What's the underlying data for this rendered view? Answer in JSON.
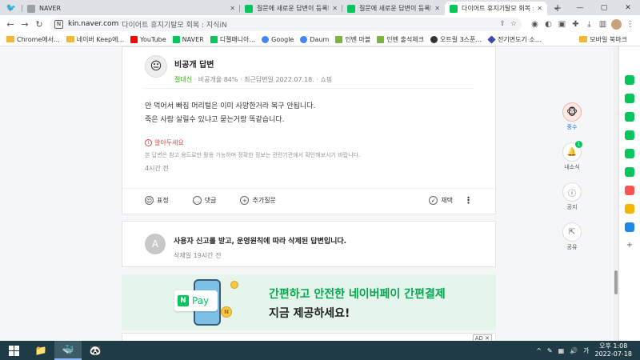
{
  "browser": {
    "tabs": [
      {
        "title": "",
        "pinned": true,
        "icon": "twitter-bird-icon"
      },
      {
        "title": "NAVER",
        "pinned": false
      },
      {
        "title": "질문에 새로운 답변이 등록되었",
        "pinned": false
      },
      {
        "title": "질문에 새로운 답변이 등록되었",
        "pinned": false
      },
      {
        "title": "다이어트 휴지기탈모 회복 : 지식",
        "pinned": false,
        "active": true
      }
    ],
    "new_tab": "+",
    "url": "kin.naver.com",
    "url_title": "다이어트 휴지기탈모 회복 : 지식iN",
    "omnibox_badge": "N",
    "window_controls": {
      "minimize": "—",
      "maximize": "▢",
      "close": "✕"
    }
  },
  "bookmarks": {
    "items": [
      {
        "label": "Chrome에서...",
        "type": "folder"
      },
      {
        "label": "네이버 Keep에...",
        "type": "folder"
      },
      {
        "label": "YouTube",
        "color": "#ff0000"
      },
      {
        "label": "NAVER",
        "color": "#03c75a"
      },
      {
        "label": "디젤매니아...",
        "color": "#03c75a"
      },
      {
        "label": "Google",
        "color": "#4285f4"
      },
      {
        "label": "Daum",
        "color": "#4285f4"
      },
      {
        "label": "인벤 마블",
        "color": "#7cb342"
      },
      {
        "label": "인벤 출석체크",
        "color": "#7cb342"
      },
      {
        "label": "오트릴 3스푼...",
        "color": "#333333"
      },
      {
        "label": "전기면도기 소...",
        "color": "#3949ab"
      }
    ],
    "right_folder": "모바일 북마크"
  },
  "answer": {
    "title": "비공개 답변",
    "grade": "절대신",
    "meta_rest": "· 비공개율 84% · 최근답변일 2022.07.18. · 쇼핑",
    "body_lines": [
      "안 먹어서 빠짐 머리털은 이미 사망한거라 복구 안됩니다.",
      "죽은 사람 살릴수 있냐고 묻는거랑 똑같습니다."
    ],
    "notice_title": "알아두세요",
    "notice_body": "본 답변은 참고 용도로만 활용 가능하며 정확한 정보는 관련기관에서 확인해보시기 바랍니다.",
    "time_ago": "4시간 전",
    "actions": {
      "emoji": "표정",
      "comment": "댓글",
      "add_question": "추가질문",
      "adopt": "채택"
    }
  },
  "deleted_answer": {
    "avatar_letter": "A",
    "title": "사용자 신고를 받고, 운영원칙에 따라 삭제된 답변입니다.",
    "time": "삭제일 19시간 전"
  },
  "banner": {
    "pay_logo_n": "N",
    "pay_logo_text": "Pay",
    "line1": "간편하고 안전한 네이버페이 간편결제",
    "line2": "지금 제공하세요!",
    "coin_mark": "N"
  },
  "ad": {
    "tag": "AD ✕"
  },
  "float_rail": {
    "mascot_label": "중수",
    "news_label": "내소식",
    "news_badge": "1",
    "notice_label": "공지",
    "share_label": "공유"
  },
  "taskbar": {
    "tray_time_period": "오후 1:08",
    "tray_date": "2022-07-18"
  },
  "colors": {
    "naver_green": "#03c75a",
    "banner_bg": "#e6f5ec",
    "taskbar_bg": "#1f3b45"
  }
}
